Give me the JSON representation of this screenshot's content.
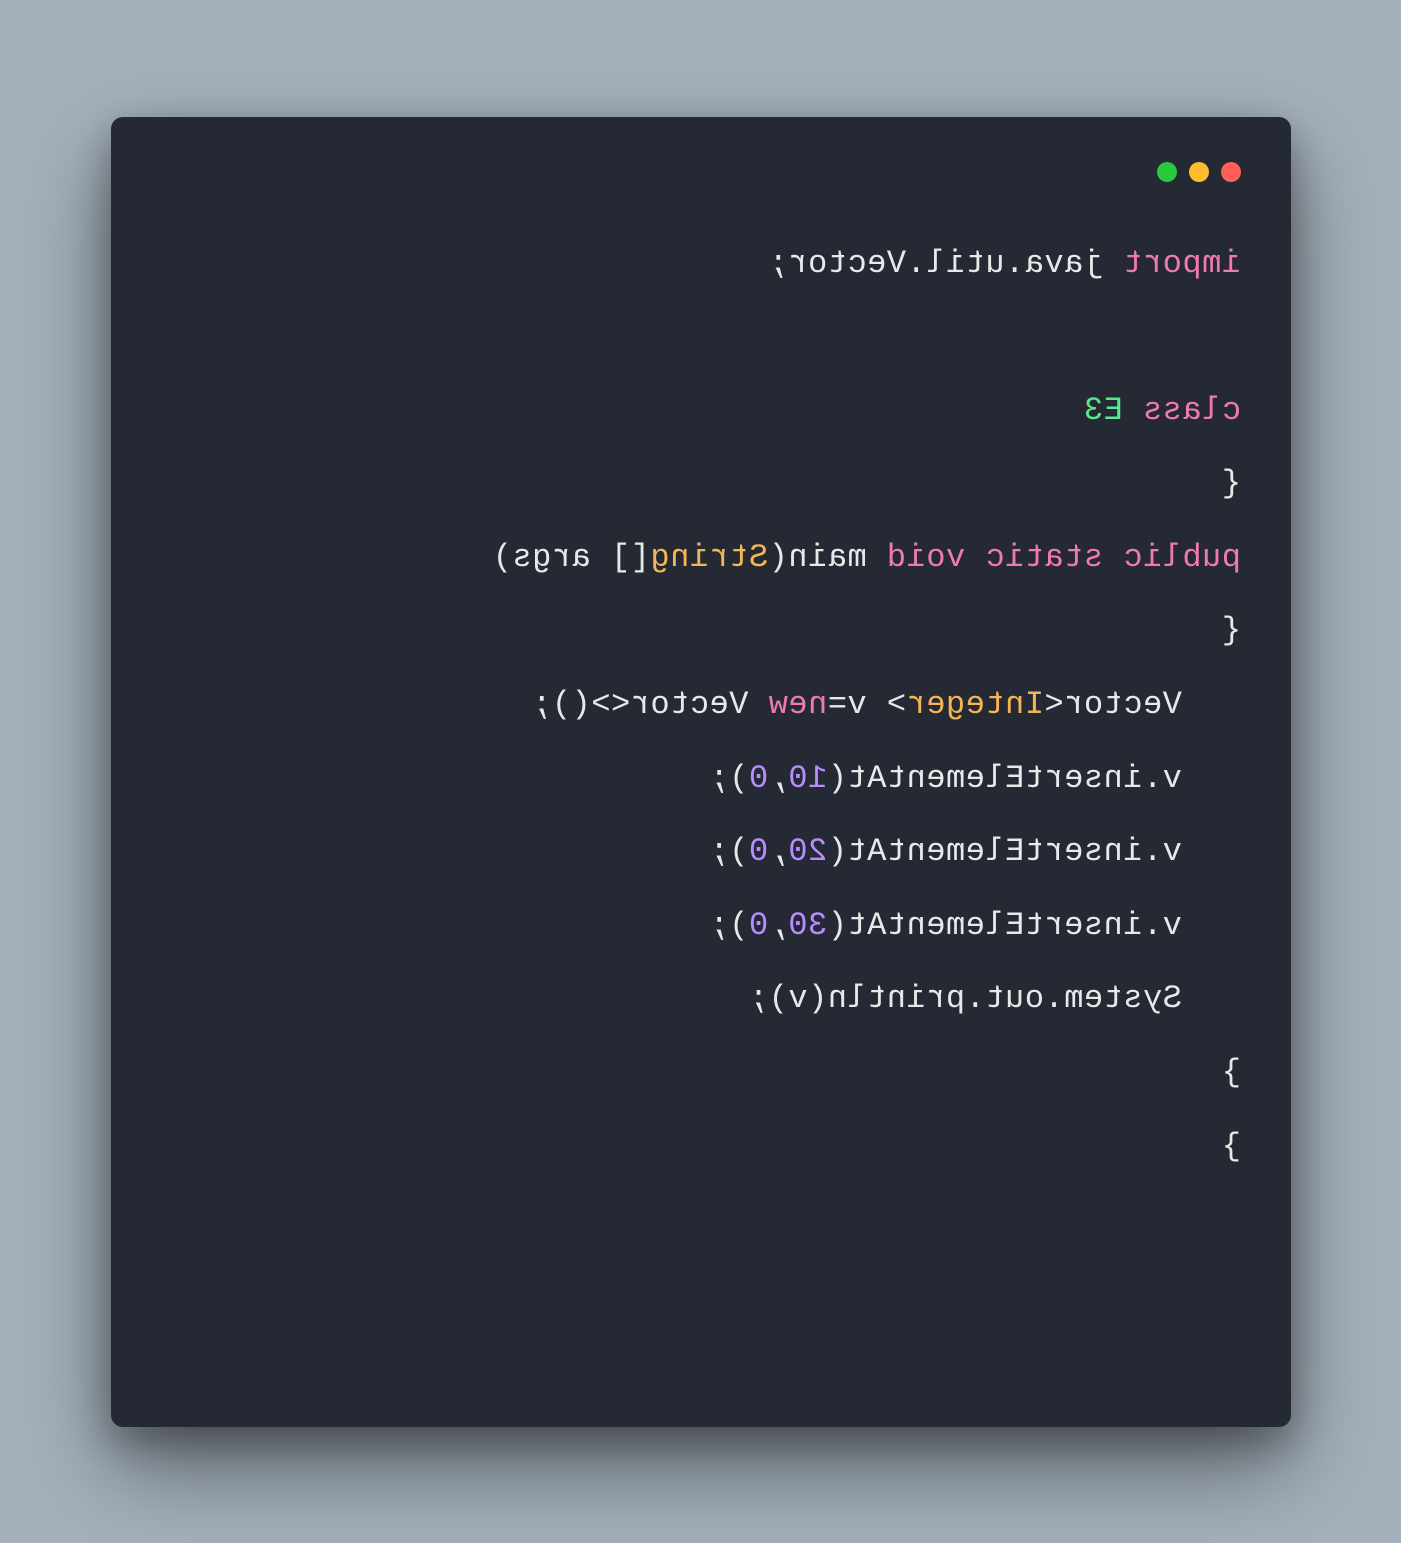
{
  "traffic_lights": {
    "red": "#ff5f56",
    "yellow": "#ffbd2e",
    "green": "#27c93f"
  },
  "code": {
    "l1_import": "import",
    "l1_rest": " java.util.Vector;",
    "l3_class": "class ",
    "l3_name": "E3",
    "l4_brace": "{",
    "l5_mods": "public static void",
    "l5_main": " main(",
    "l5_type": "String",
    "l5_args": "[] args)",
    "l6_brace": "{",
    "l7_a": "Vector<",
    "l7_int": "Integer",
    "l7_b": "> v=",
    "l7_new": "new",
    "l7_c": " Vector<>();",
    "l8_a": "v.insertElementAt(",
    "l8_n1": "10",
    "l8_m": ",",
    "l8_n2": "0",
    "l8_z": ");",
    "l9_a": "v.insertElementAt(",
    "l9_n1": "20",
    "l9_m": ",",
    "l9_n2": "0",
    "l9_z": ");",
    "l10_a": "v.insertElementAt(",
    "l10_n1": "30",
    "l10_m": ",",
    "l10_n2": "0",
    "l10_z": ");",
    "l11": "System.out.println(v);",
    "l12_brace": "}",
    "l13_brace": "}"
  }
}
